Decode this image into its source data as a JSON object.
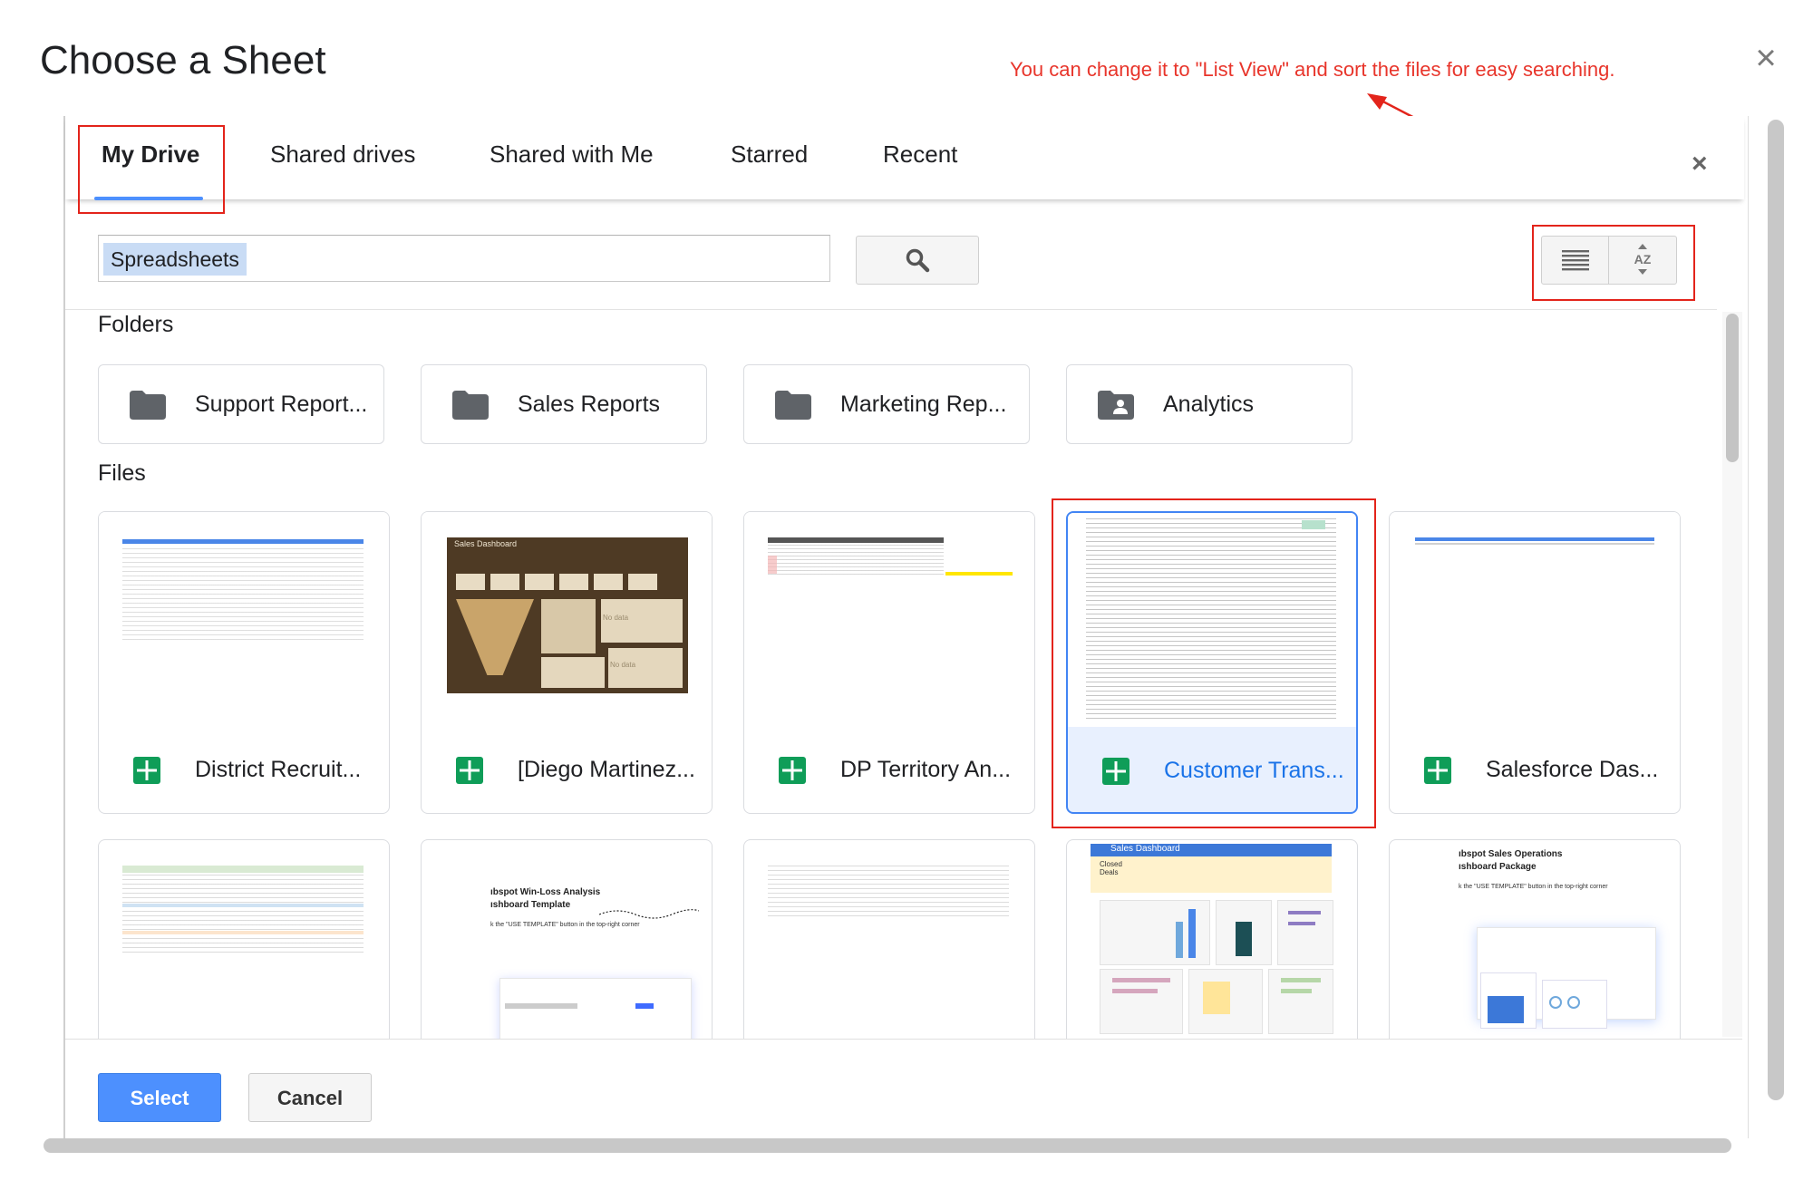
{
  "dialog": {
    "title": "Choose a Sheet"
  },
  "annotation": {
    "text": "You can change it to \"List View\" and sort the files for easy searching."
  },
  "tabs": [
    {
      "label": "My Drive"
    },
    {
      "label": "Shared drives"
    },
    {
      "label": "Shared with Me"
    },
    {
      "label": "Starred"
    },
    {
      "label": "Recent"
    }
  ],
  "search": {
    "value": "Spreadsheets"
  },
  "sections": {
    "folders": "Folders",
    "files": "Files"
  },
  "folders": [
    {
      "label": "Support Report..."
    },
    {
      "label": "Sales Reports"
    },
    {
      "label": "Marketing Rep..."
    },
    {
      "label": "Analytics"
    }
  ],
  "files": [
    {
      "label": "District Recruit..."
    },
    {
      "label": "[Diego Martinez..."
    },
    {
      "label": "DP Territory An..."
    },
    {
      "label": "Customer Trans..."
    },
    {
      "label": "Salesforce Das..."
    }
  ],
  "thumbs": {
    "sales_dashboard": "Sales Dashboard",
    "no_data": "No data",
    "winloss_l1": "ıbspot Win-Loss Analysis",
    "winloss_l2": "ıshboard Template",
    "winloss_l3": "k the \"USE TEMPLATE\" button in the top-right corner",
    "closed_deals": "Closed Deals",
    "ops_l1": "ıbspot Sales Operations",
    "ops_l2": "ıshboard Package",
    "ops_l3": "k the \"USE TEMPLATE\" button in the top-right corner"
  },
  "buttons": {
    "select": "Select",
    "cancel": "Cancel"
  },
  "colors": {
    "accent": "#4d90fe",
    "annotation": "#e8352b",
    "sheets_green": "#0f9d58"
  }
}
